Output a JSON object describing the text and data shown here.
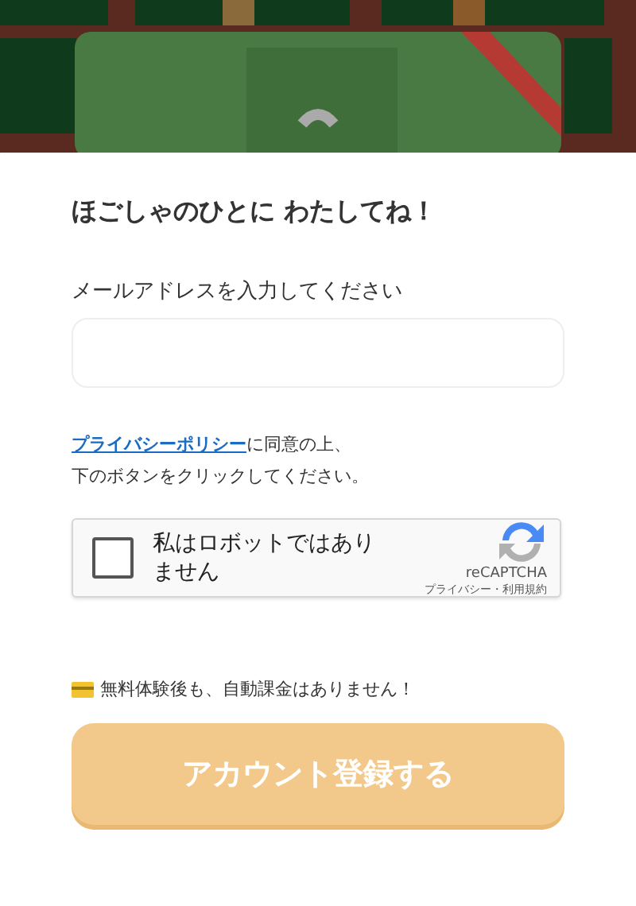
{
  "heading": "ほごしゃのひとに わたしてね！",
  "email": {
    "label": "メールアドレスを入力してください"
  },
  "consent": {
    "link": "プライバシーポリシー",
    "text": "に同意の上、",
    "line2": "下のボタンをクリックしてください。"
  },
  "captcha": {
    "checked": false,
    "label": "私はロボットではありません",
    "brand": "reCAPTCHA",
    "links": "プライバシー・利用規約"
  },
  "note": "無料体験後も、自動課金はありません！",
  "submit": {
    "label": "アカウント登録する",
    "disabled": true
  }
}
